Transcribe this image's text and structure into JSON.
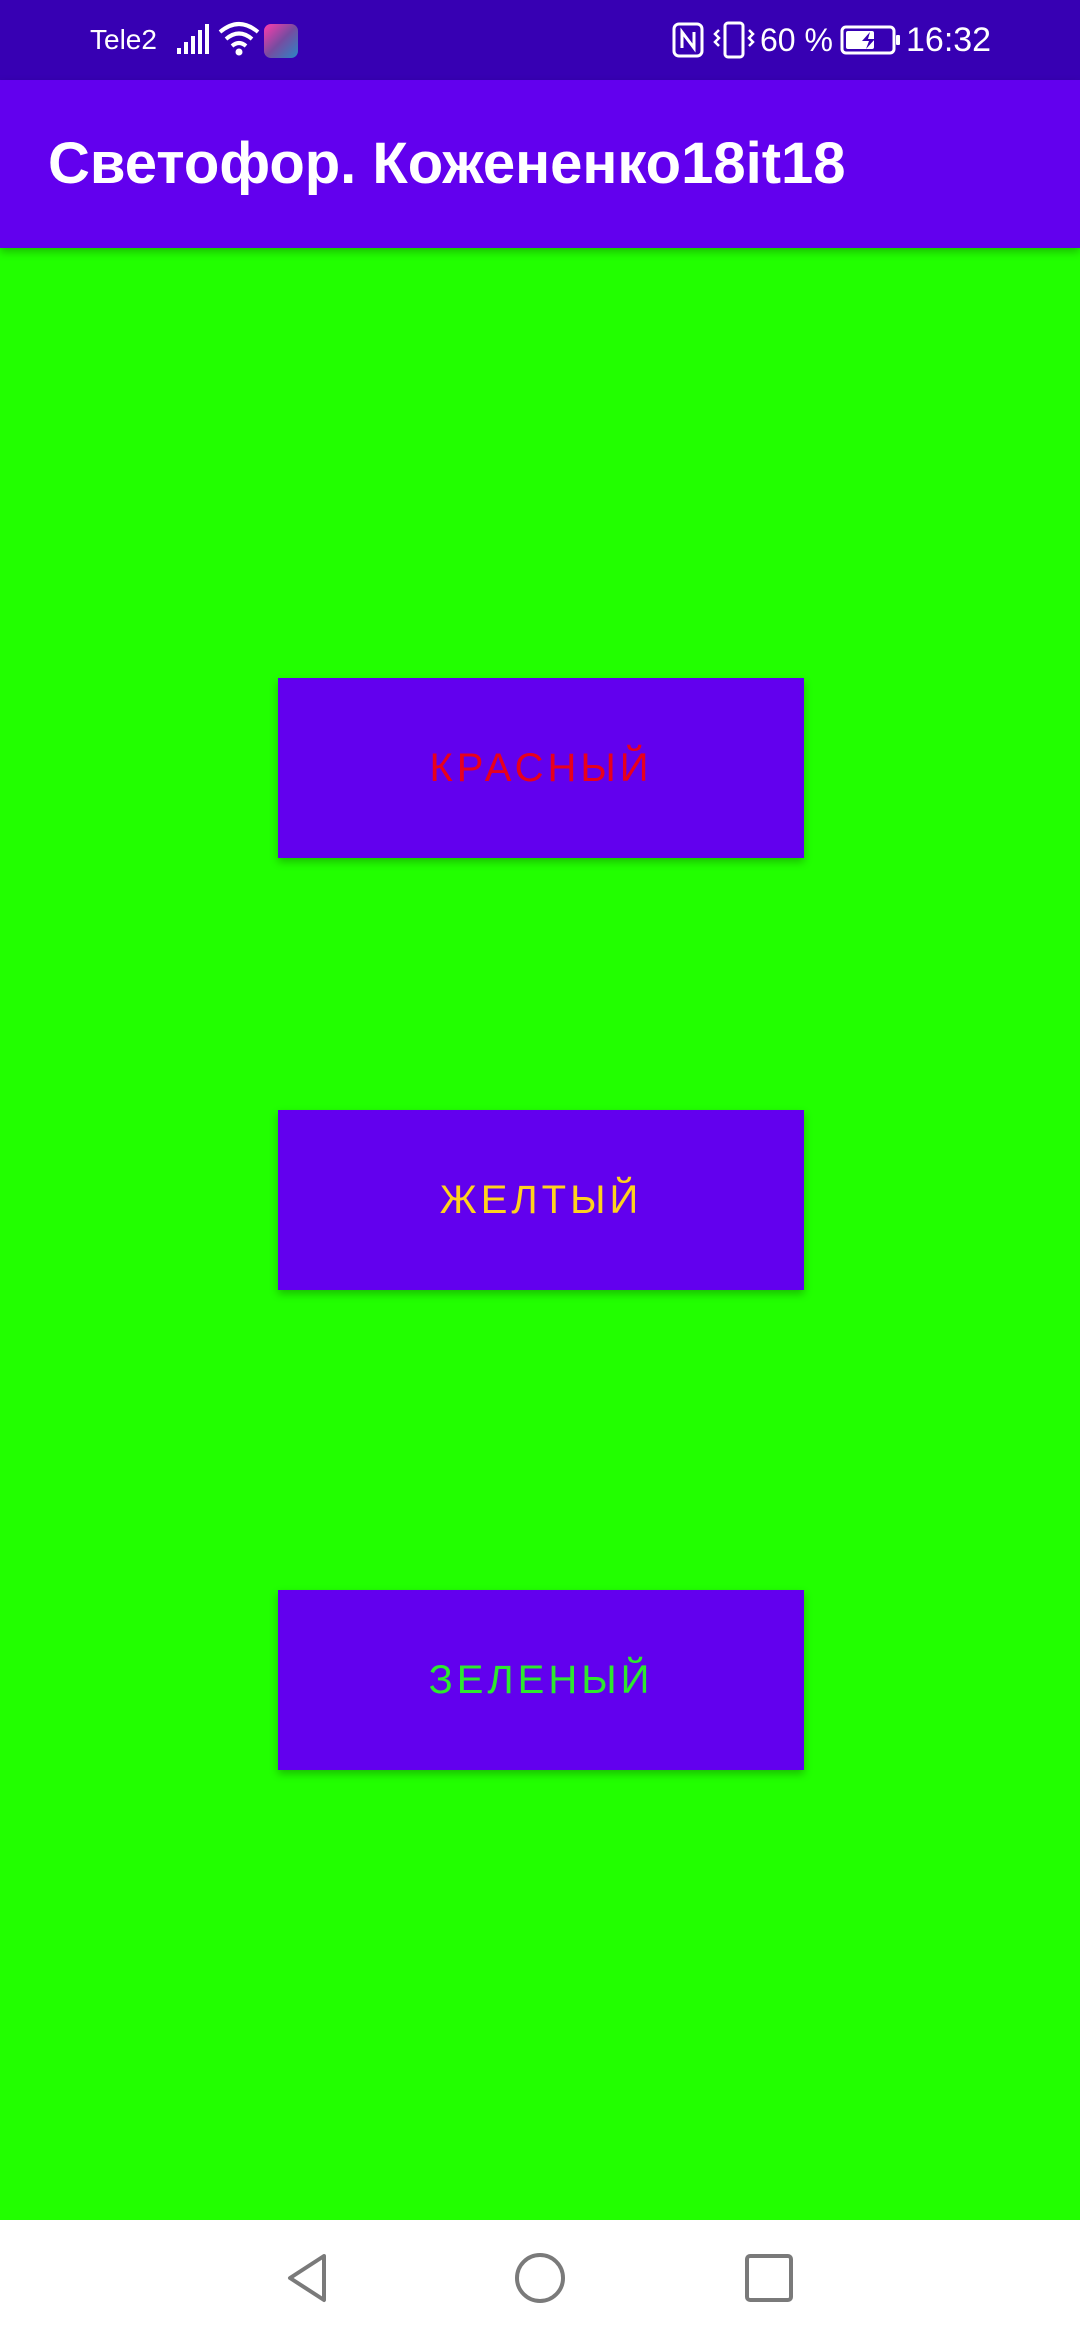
{
  "status_bar": {
    "carrier": "Tele2",
    "battery_percent": "60 %",
    "clock": "16:32",
    "icons": [
      "signal-icon",
      "wifi-icon",
      "app-badge-icon",
      "nfc-icon",
      "vibrate-icon",
      "battery-charging-icon"
    ]
  },
  "app_bar": {
    "title": "Светофор. Кожененко18it18",
    "color": "#6200ee"
  },
  "content": {
    "background_color": "#22ff00",
    "buttons": [
      {
        "label": "КРАСНЫЙ",
        "text_color": "#e8001c"
      },
      {
        "label": "ЖЕЛТЫЙ",
        "text_color": "#ffd21e"
      },
      {
        "label": "ЗЕЛЕНЫЙ",
        "text_color": "#2ee82e"
      }
    ],
    "button_color": "#6200ee"
  },
  "nav_bar": {
    "icons": [
      "back-icon",
      "home-icon",
      "recent-apps-icon"
    ]
  }
}
